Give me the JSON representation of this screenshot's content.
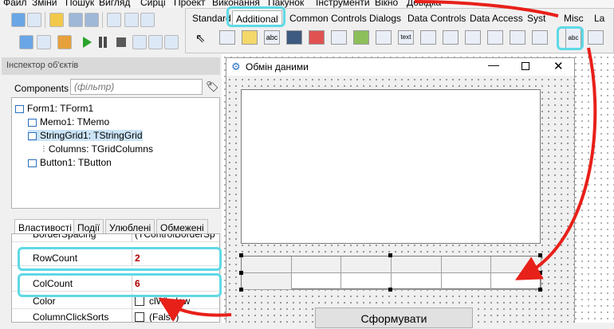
{
  "menu": [
    "Файл",
    "Зміни",
    "Пошук",
    "Вигляд",
    "Сирці",
    "Проект",
    "Виконання",
    "Пакунок",
    "Інструменти",
    "Вікно",
    "Довідка"
  ],
  "palette": {
    "tabs": [
      "Standard",
      "Additional",
      "Common Controls",
      "Dialogs",
      "Data Controls",
      "Data Access",
      "Syst",
      "Misc",
      "La"
    ],
    "icon_labels": [
      "abc",
      "text",
      "abc"
    ]
  },
  "inspector": {
    "title": "Інспектор об'єктів",
    "components_label": "Components",
    "filter_placeholder": "(фільтр)",
    "tree": [
      {
        "label": "Form1: TForm1"
      },
      {
        "label": "Memo1: TMemo"
      },
      {
        "label": "StringGrid1: TStringGrid"
      },
      {
        "label": "Columns: TGridColumns"
      },
      {
        "label": "Button1: TButton"
      }
    ],
    "tabs": [
      "Властивості",
      "Події",
      "Улюблені",
      "Обмежені"
    ],
    "properties": [
      {
        "name": "BorderSpacing",
        "value": "(TControlBorderSp"
      },
      {
        "name": "RowCount",
        "value": "2"
      },
      {
        "name": "ColCount",
        "value": "6"
      },
      {
        "name": "Color",
        "value": "clWindow"
      },
      {
        "name": "ColumnClickSorts",
        "value": "(False)"
      }
    ]
  },
  "form": {
    "title": "Обмін даними",
    "button_label": "Сформувати",
    "grid_cols": 6,
    "grid_rows": 2
  },
  "colors": {
    "highlight": "#5ed9e6",
    "arrow": "#e8201a"
  }
}
